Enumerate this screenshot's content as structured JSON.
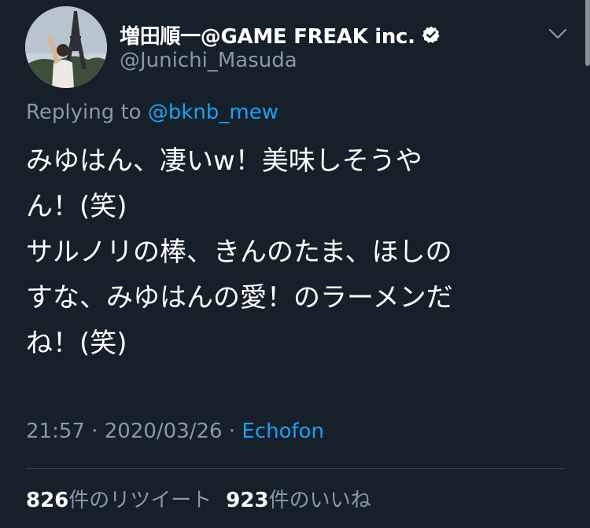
{
  "author": {
    "display_name": "増田順一@GAME FREAK inc.",
    "handle": "@Junichi_Masuda"
  },
  "reply": {
    "prefix": "Replying to",
    "mention": "@bknb_mew"
  },
  "tweet": {
    "lines": [
      "みゆはん、凄いw！美味しそうや",
      "ん！(笑)",
      "サルノリの棒、きんのたま、ほしの",
      "すな、みゆはんの愛！のラーメンだ",
      "ね！(笑)"
    ]
  },
  "meta": {
    "time": "21:57",
    "separator": "·",
    "date": "2020/03/26",
    "source": "Echofon"
  },
  "stats": {
    "retweets_count": "826",
    "retweets_label": "件のリツイート",
    "likes_count": "923",
    "likes_label": "件のいいね"
  },
  "colors": {
    "background": "#15202b",
    "primary_text": "#ffffff",
    "secondary_text": "#8899a6",
    "link": "#1da1f2",
    "divider": "#38444d"
  },
  "icons": {
    "verified": "verified-badge-icon",
    "menu": "chevron-down-icon"
  }
}
